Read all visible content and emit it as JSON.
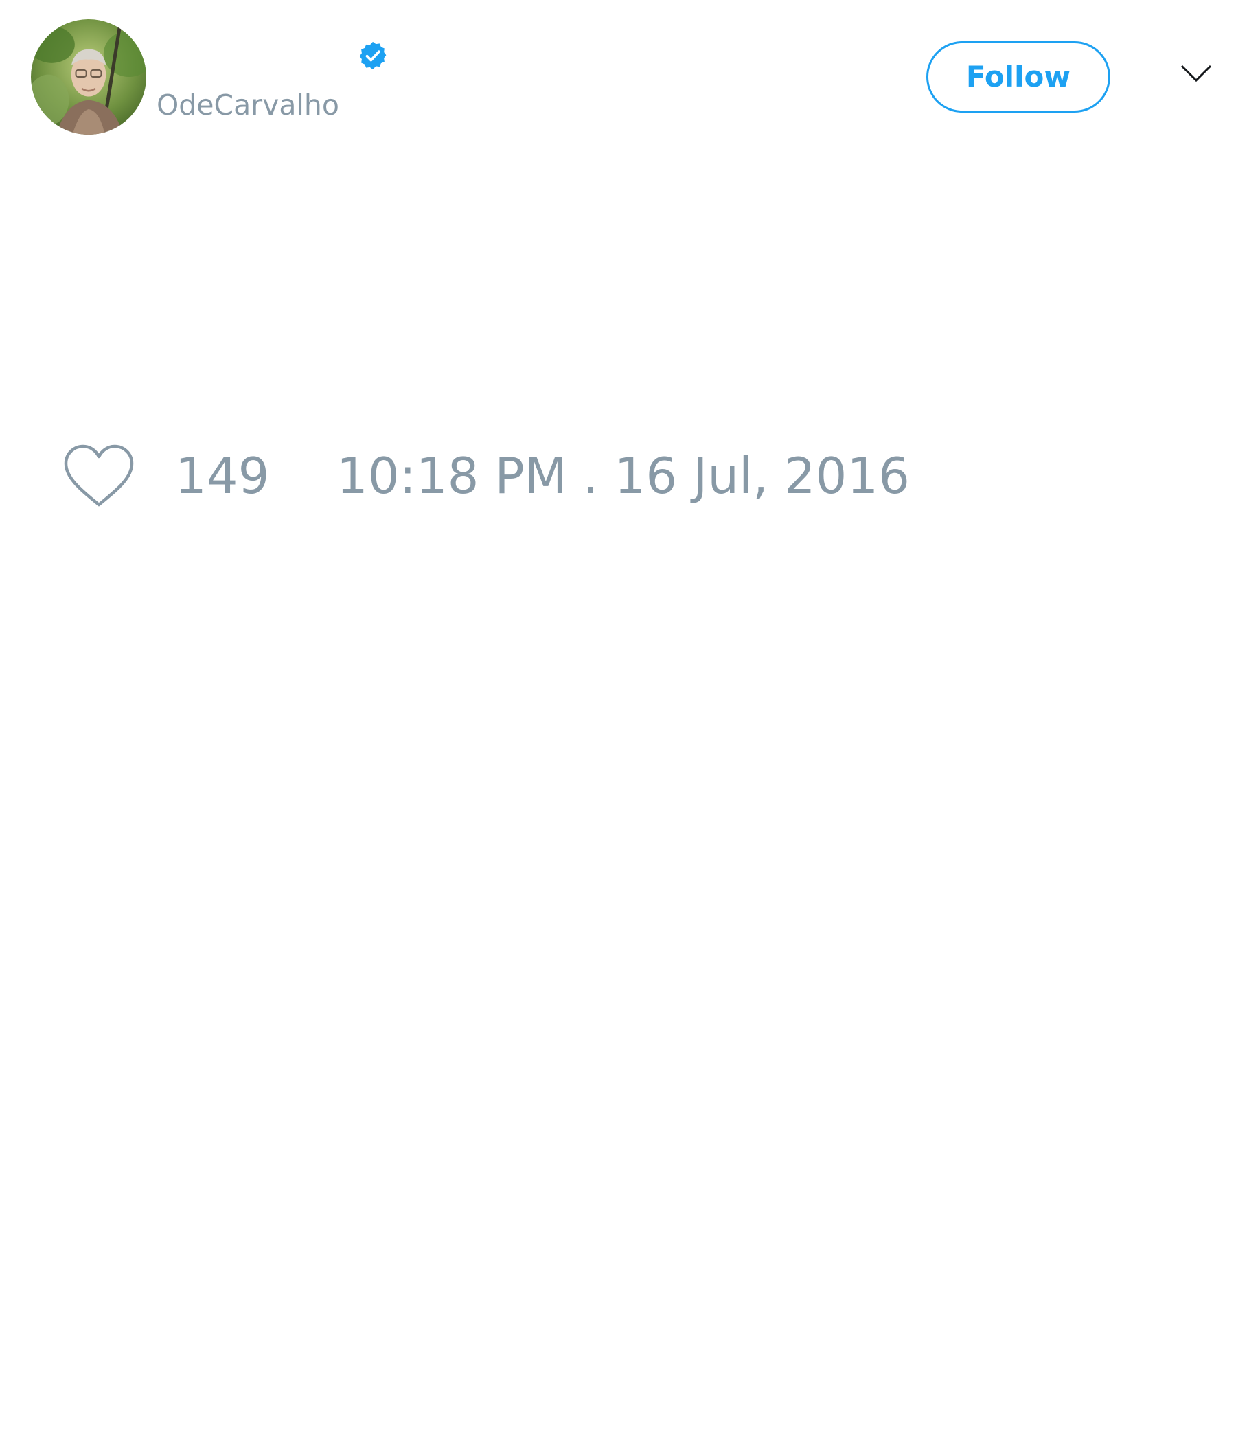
{
  "author": {
    "handle": "OdeCarvalho",
    "verified": true,
    "avatar_icon": "profile-photo"
  },
  "header": {
    "follow_label": "Follow",
    "menu_icon": "chevron-down-icon"
  },
  "meta": {
    "like_icon": "heart-icon",
    "like_count": "149",
    "timestamp": "10:18 PM . 16 Jul, 2016"
  },
  "colors": {
    "accent": "#1da1f2",
    "muted_text": "#8899a6",
    "background": "#ffffff"
  }
}
